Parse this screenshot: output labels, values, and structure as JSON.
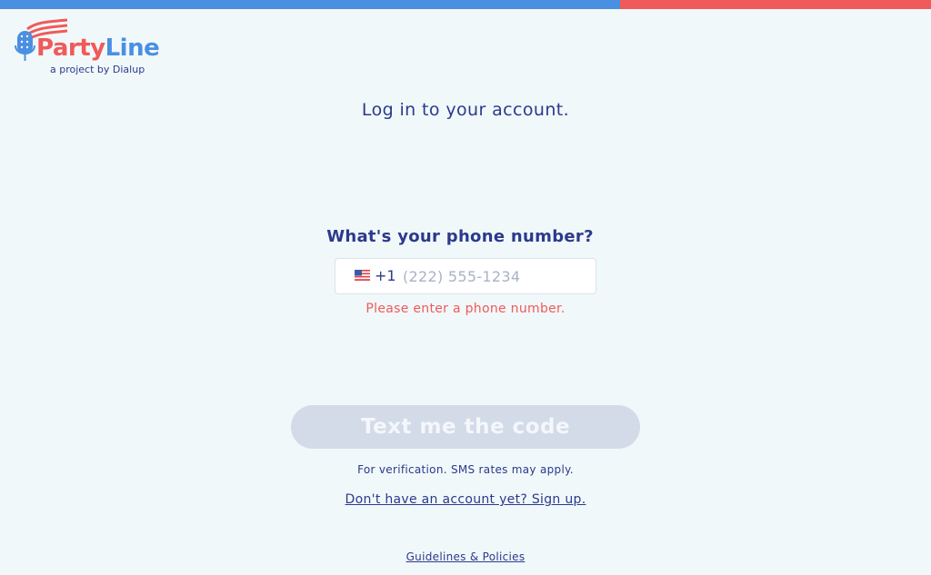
{
  "brand": {
    "name_part1": "Party",
    "name_part2": "Line",
    "tagline": "a project by Dialup",
    "colors": {
      "blue": "#4a90e2",
      "red": "#f05a5a",
      "navy": "#2b3a8c"
    }
  },
  "login": {
    "title": "Log in to your account.",
    "question": "What's your phone number?",
    "country_flag": "us-flag-icon",
    "country_code": "+1",
    "phone_placeholder": "(222) 555-1234",
    "phone_value": "",
    "error": "Please enter a phone number.",
    "submit_label": "Text me the code",
    "note": "For verification. SMS rates may apply.",
    "signup_link": "Don't have an account yet? Sign up."
  },
  "footer": {
    "guidelines_link": "Guidelines & Policies"
  }
}
